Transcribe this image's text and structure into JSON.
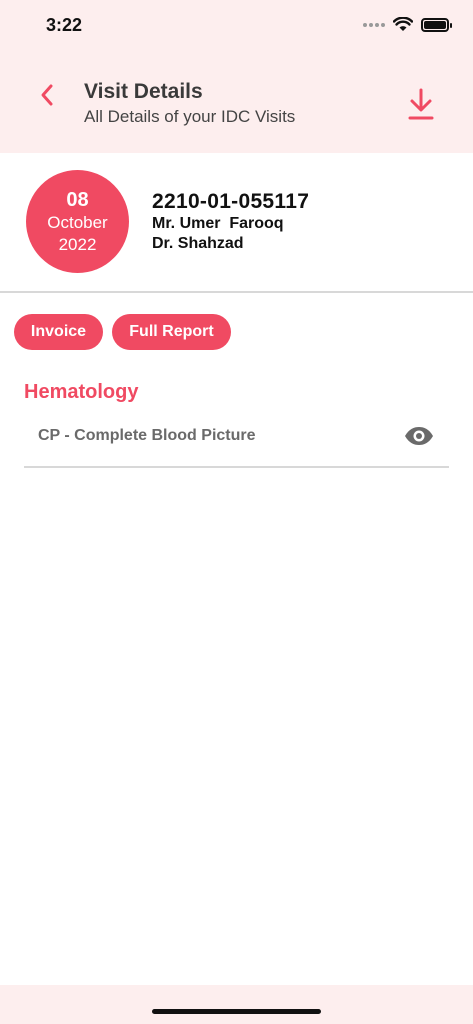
{
  "status_bar": {
    "time": "3:22"
  },
  "header": {
    "title": "Visit Details",
    "subtitle": "All Details of your IDC Visits"
  },
  "visit": {
    "day": "08",
    "month": "October",
    "year": "2022",
    "visit_id": "2210-01-055117",
    "patient": "Mr. Umer  Farooq",
    "doctor": "Dr. Shahzad"
  },
  "actions": {
    "invoice_label": "Invoice",
    "full_report_label": "Full Report"
  },
  "sections": [
    {
      "title": "Hematology",
      "tests": [
        {
          "name": "CP - Complete Blood Picture",
          "icon": "eye-icon"
        }
      ]
    }
  ],
  "colors": {
    "accent": "#f04a62",
    "header_bg": "#fdeeee"
  },
  "icons": {
    "back": "chevron-left-icon",
    "download": "download-icon",
    "view": "eye-icon"
  }
}
